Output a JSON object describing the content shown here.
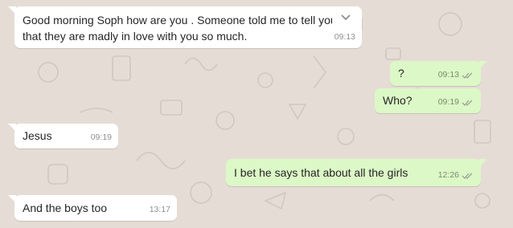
{
  "chat": {
    "colors": {
      "background": "#e5ddd5",
      "incoming_bubble": "#ffffff",
      "outgoing_bubble": "#dcf8c6",
      "read_ticks": "#4fc3f7"
    },
    "messages": [
      {
        "direction": "incoming",
        "text_line1": "Good morning Soph  how are you . Someone told me to tell you",
        "text_line2": "that they are madly in  love with you so much.",
        "time": "09:13",
        "menu_icon": "chevron-down-icon"
      },
      {
        "direction": "outgoing",
        "text": "?",
        "time": "09:13",
        "status_icon": "double-check-icon"
      },
      {
        "direction": "outgoing",
        "text": "Who?",
        "time": "09:19",
        "status_icon": "double-check-icon"
      },
      {
        "direction": "incoming",
        "text": "Jesus",
        "time": "09:19"
      },
      {
        "direction": "outgoing",
        "text": "I bet he says that about all the girls",
        "time": "12:26",
        "status_icon": "double-check-icon"
      },
      {
        "direction": "incoming",
        "text": "And the boys too",
        "time": "13:17"
      }
    ]
  }
}
